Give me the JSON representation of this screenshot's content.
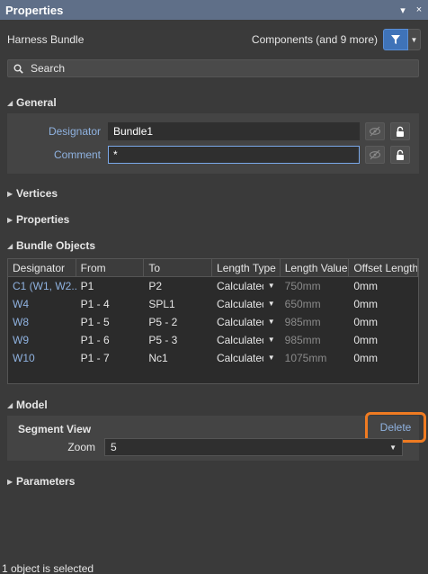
{
  "window": {
    "title": "Properties",
    "pin_glyph": "▾",
    "close_glyph": "×"
  },
  "header": {
    "object": "Harness Bundle",
    "filter_label": "Components (and 9 more)"
  },
  "search": {
    "placeholder": "Search"
  },
  "sections": {
    "general": "General",
    "vertices": "Vertices",
    "properties": "Properties",
    "bundle_objects": "Bundle Objects",
    "model": "Model",
    "parameters": "Parameters"
  },
  "general": {
    "designator_label": "Designator",
    "designator_value": "Bundle1",
    "comment_label": "Comment",
    "comment_value": "*"
  },
  "bundle_table": {
    "headers": [
      "Designator",
      "From",
      "To",
      "Length Type",
      "Length Value",
      "Offset Length"
    ],
    "rows": [
      [
        "C1 (W1, W2...",
        "P1",
        "P2",
        "Calculated",
        "750mm",
        "0mm"
      ],
      [
        "W4",
        "P1 - 4",
        "SPL1",
        "Calculated",
        "650mm",
        "0mm"
      ],
      [
        "W8",
        "P1 - 5",
        "P5 - 2",
        "Calculated",
        "985mm",
        "0mm"
      ],
      [
        "W9",
        "P1 - 6",
        "P5 - 3",
        "Calculated",
        "985mm",
        "0mm"
      ],
      [
        "W10",
        "P1 - 7",
        "Nc1",
        "Calculated",
        "1075mm",
        "0mm"
      ]
    ]
  },
  "model": {
    "segment_view": "Segment View",
    "delete_label": "Delete",
    "zoom_label": "Zoom",
    "zoom_value": "5"
  },
  "status": "1 object is selected",
  "colors": {
    "accent": "#3f73b8",
    "link": "#8fb2e0",
    "highlight": "#ef7b22",
    "titlebar": "#5f6f88"
  }
}
